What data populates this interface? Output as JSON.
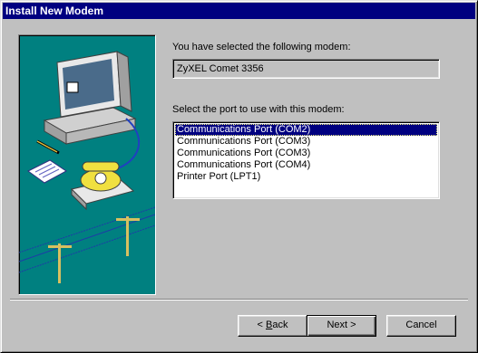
{
  "window": {
    "title": "Install New Modem"
  },
  "selected_modem": {
    "label": "You have selected the following modem:",
    "value": "ZyXEL Comet 3356"
  },
  "port_select": {
    "label": "Select the port to use with this modem:",
    "options": [
      "Communications Port (COM2)",
      "Communications Port (COM3)",
      "Communications Port (COM3)",
      "Communications Port (COM4)",
      "Printer Port (LPT1)"
    ],
    "selected_index": 0
  },
  "buttons": {
    "back_prefix": "< ",
    "back_mnemonic": "B",
    "back_rest": "ack",
    "next": "Next >",
    "cancel": "Cancel"
  },
  "colors": {
    "titlebar": "#000080",
    "illustration_bg": "#008080",
    "face": "#c0c0c0"
  },
  "icons": [
    "computer-icon",
    "telephone-icon",
    "notepad-icon",
    "pencil-icon",
    "phone-line-icon"
  ]
}
